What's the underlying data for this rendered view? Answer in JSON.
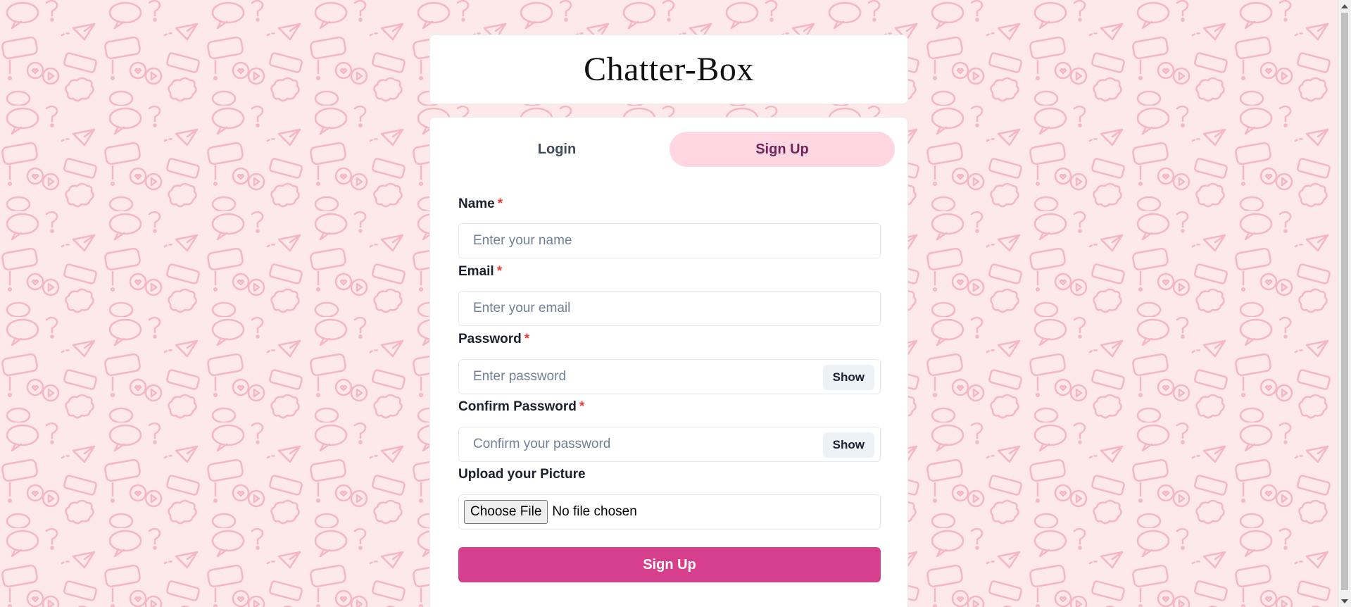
{
  "app": {
    "title": "Chatter-Box"
  },
  "tabs": [
    {
      "label": "Login",
      "active": false
    },
    {
      "label": "Sign Up",
      "active": true
    }
  ],
  "form": {
    "name": {
      "label": "Name",
      "required_mark": "*",
      "placeholder": "Enter your name",
      "value": ""
    },
    "email": {
      "label": "Email",
      "required_mark": "*",
      "placeholder": "Enter your email",
      "value": ""
    },
    "password": {
      "label": "Password",
      "required_mark": "*",
      "placeholder": "Enter password",
      "value": "",
      "toggle_label": "Show"
    },
    "confirm_password": {
      "label": "Confirm Password",
      "required_mark": "*",
      "placeholder": "Confirm your password",
      "value": "",
      "toggle_label": "Show"
    },
    "picture": {
      "label": "Upload your Picture",
      "button_label": "Choose File",
      "status": "No file chosen"
    },
    "submit_label": "Sign Up"
  },
  "colors": {
    "background": "#fde8ea",
    "pattern": "#f6b3bf",
    "active_tab": "#fed7e2",
    "active_tab_text": "#702459",
    "submit": "#d53f8c",
    "required": "#e53e3e"
  },
  "icons": {
    "background": [
      "speech-bubble-icon",
      "question-mark-icon",
      "exclamation-mark-icon",
      "heart-icon",
      "play-icon",
      "paper-plane-icon",
      "cloud-bubble-icon"
    ],
    "scrollbar": [
      "scroll-up-arrow-icon",
      "scroll-down-arrow-icon"
    ]
  }
}
